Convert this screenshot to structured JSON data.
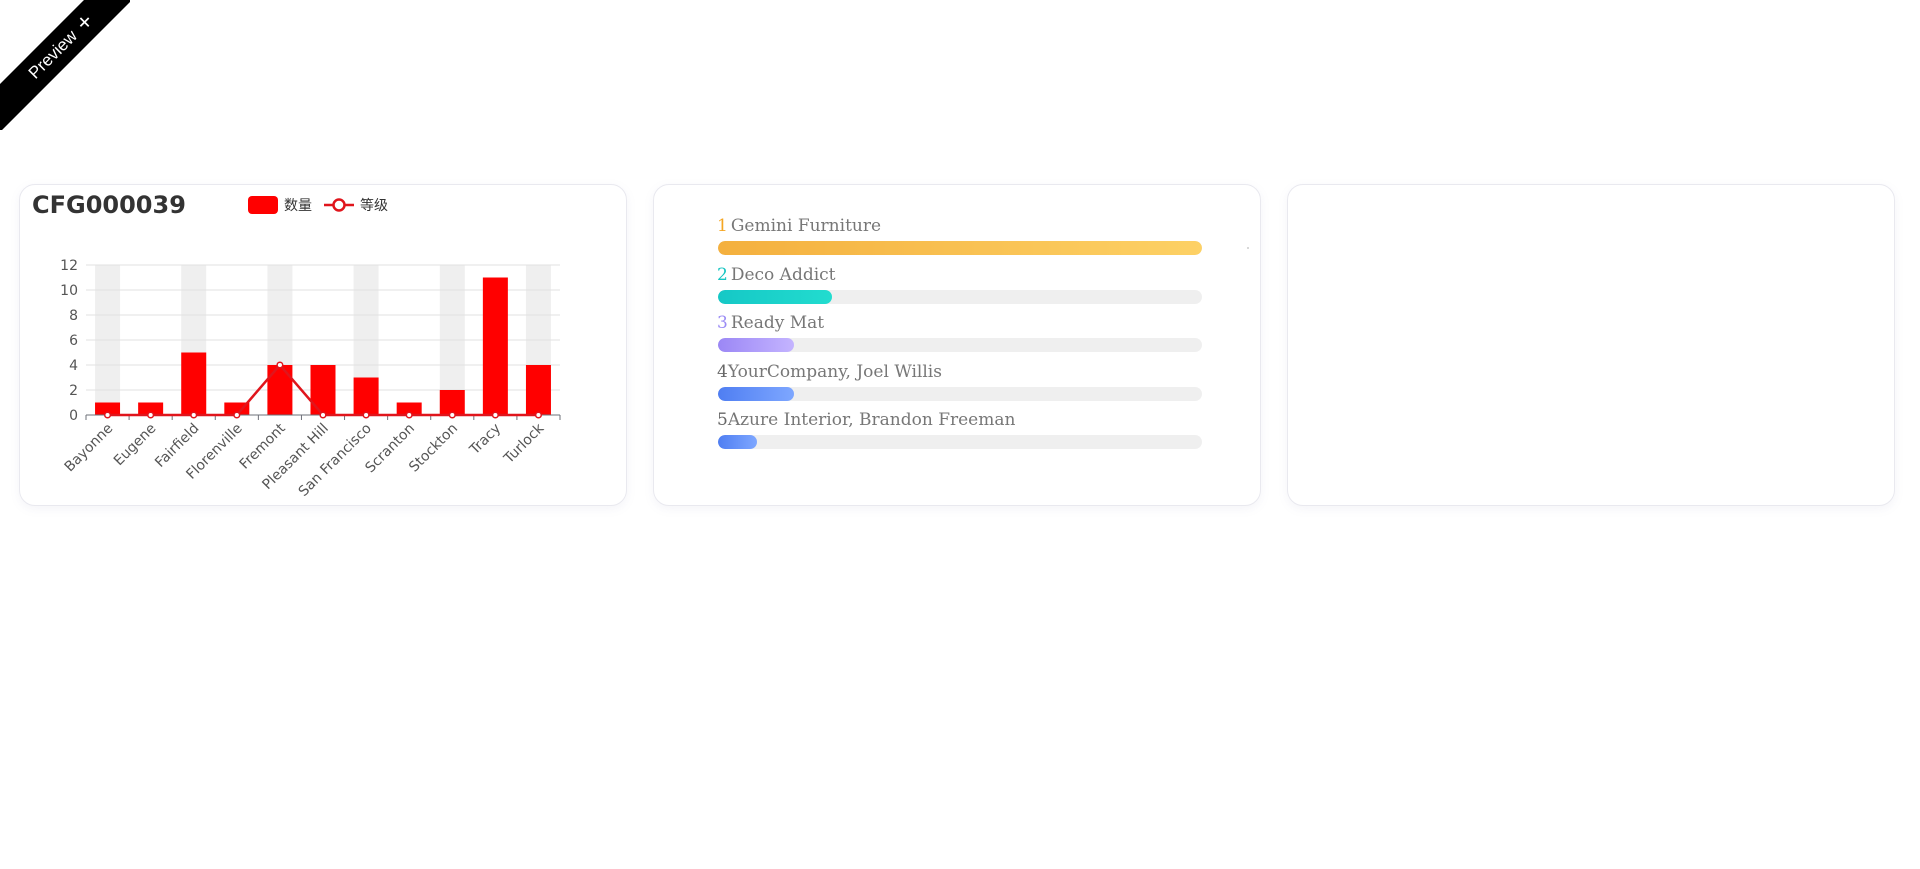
{
  "preview": {
    "label": "Preview",
    "plus": "+"
  },
  "chart_card": {
    "title": "CFG000039",
    "legend": {
      "bar": "数量",
      "line": "等级"
    }
  },
  "chart_data": {
    "type": "bar",
    "categories": [
      "Bayonne",
      "Eugene",
      "Fairfield",
      "Florenville",
      "Fremont",
      "Pleasant Hill",
      "San Francisco",
      "Scranton",
      "Stockton",
      "Tracy",
      "Turlock"
    ],
    "series": [
      {
        "name": "数量",
        "type": "bar",
        "color": "#ff0000",
        "values": [
          1,
          1,
          5,
          1,
          4,
          4,
          3,
          1,
          2,
          11,
          4
        ]
      },
      {
        "name": "等级",
        "type": "line",
        "color": "#e0151c",
        "values": [
          0,
          0,
          0,
          0,
          4,
          0,
          0,
          0,
          0,
          0,
          0
        ]
      }
    ],
    "title": "CFG000039",
    "ylim": [
      0,
      12
    ],
    "yticks": [
      0,
      2,
      4,
      6,
      8,
      10,
      12
    ],
    "grid": true,
    "legend_position": "top"
  },
  "ranking": {
    "items": [
      {
        "rank": "1",
        "name": "Gemini Furniture",
        "fraction": 1.0,
        "num_color": "#f5a623",
        "colors": [
          "#f4b03e",
          "#fdd165"
        ]
      },
      {
        "rank": "2",
        "name": "Deco Addict",
        "fraction": 0.235,
        "num_color": "#16c5c2",
        "colors": [
          "#15c8c6",
          "#22dccf"
        ]
      },
      {
        "rank": "3",
        "name": "Ready Mat",
        "fraction": 0.158,
        "num_color": "#9b8cf5",
        "colors": [
          "#9b87f5",
          "#c4b4ff"
        ]
      },
      {
        "rank": "4",
        "name": "YourCompany, Joel Willis",
        "fraction": 0.158,
        "num_color": "#666666",
        "colors": [
          "#4f7ef2",
          "#7ea7ff"
        ]
      },
      {
        "rank": "5",
        "name": "Azure Interior, Brandon Freeman",
        "fraction": 0.08,
        "num_color": "#666666",
        "colors": [
          "#4f7ef2",
          "#7ea7ff"
        ]
      }
    ]
  }
}
